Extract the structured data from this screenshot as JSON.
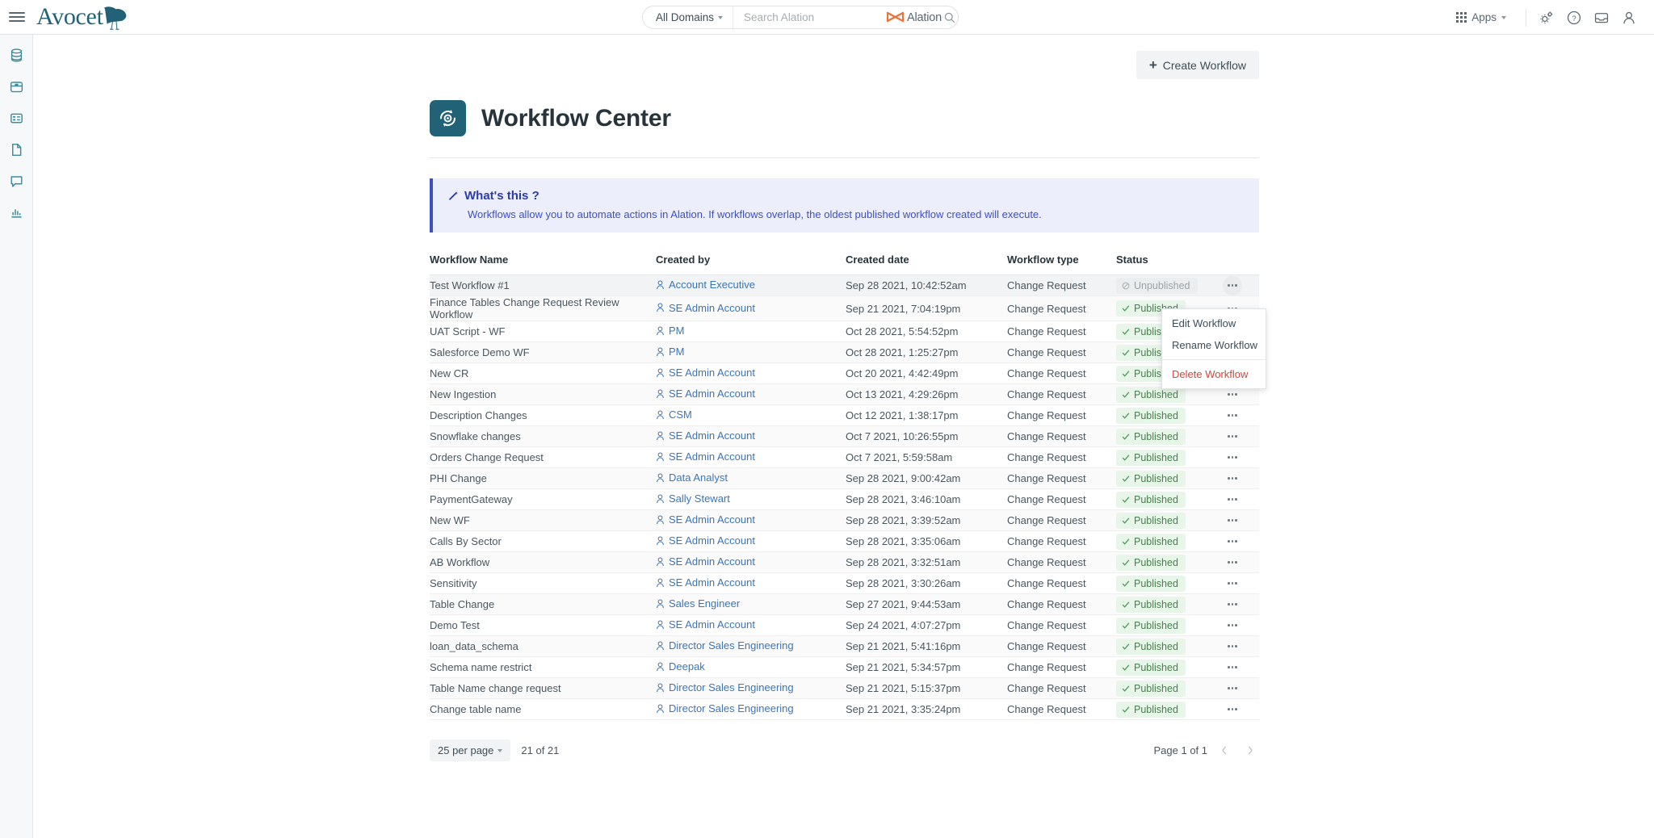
{
  "topbar": {
    "brand": "Avocet",
    "domain_selector": "All Domains",
    "search_placeholder": "Search Alation",
    "alation_label": "Alation",
    "apps_label": "Apps"
  },
  "sidebar": {
    "items": [
      {
        "name": "sidebar-item-sources",
        "icon": "database-icon"
      },
      {
        "name": "sidebar-item-catalog",
        "icon": "archive-box-icon"
      },
      {
        "name": "sidebar-item-tables",
        "icon": "table-icon"
      },
      {
        "name": "sidebar-item-documents",
        "icon": "document-icon"
      },
      {
        "name": "sidebar-item-conversations",
        "icon": "chat-bubble-icon"
      },
      {
        "name": "sidebar-item-analytics",
        "icon": "bar-chart-icon"
      }
    ]
  },
  "header": {
    "create_button": "Create Workflow",
    "title": "Workflow Center"
  },
  "banner": {
    "title": "What's this ?",
    "body": "Workflows allow you to automate actions in Alation. If workflows overlap, the oldest published workflow created will execute."
  },
  "table": {
    "columns": [
      "Workflow Name",
      "Created by",
      "Created date",
      "Workflow type",
      "Status"
    ],
    "rows": [
      {
        "name": "Test Workflow #1",
        "created_by": "Account Executive",
        "created_date": "Sep 28 2021, 10:42:52am",
        "type": "Change Request",
        "status": "Unpublished"
      },
      {
        "name": "Finance Tables Change Request Review Workflow",
        "created_by": "SE Admin Account",
        "created_date": "Sep 21 2021, 7:04:19pm",
        "type": "Change Request",
        "status": "Published"
      },
      {
        "name": "UAT Script - WF",
        "created_by": "PM",
        "created_date": "Oct 28 2021, 5:54:52pm",
        "type": "Change Request",
        "status": "Published"
      },
      {
        "name": "Salesforce Demo WF",
        "created_by": "PM",
        "created_date": "Oct 28 2021, 1:25:27pm",
        "type": "Change Request",
        "status": "Published"
      },
      {
        "name": "New CR",
        "created_by": "SE Admin Account",
        "created_date": "Oct 20 2021, 4:42:49pm",
        "type": "Change Request",
        "status": "Published"
      },
      {
        "name": "New Ingestion",
        "created_by": "SE Admin Account",
        "created_date": "Oct 13 2021, 4:29:26pm",
        "type": "Change Request",
        "status": "Published"
      },
      {
        "name": "Description Changes",
        "created_by": "CSM",
        "created_date": "Oct 12 2021, 1:38:17pm",
        "type": "Change Request",
        "status": "Published"
      },
      {
        "name": "Snowflake changes",
        "created_by": "SE Admin Account",
        "created_date": "Oct 7 2021, 10:26:55pm",
        "type": "Change Request",
        "status": "Published"
      },
      {
        "name": "Orders Change Request",
        "created_by": "SE Admin Account",
        "created_date": "Oct 7 2021, 5:59:58am",
        "type": "Change Request",
        "status": "Published"
      },
      {
        "name": "PHI Change",
        "created_by": "Data Analyst",
        "created_date": "Sep 28 2021, 9:00:42am",
        "type": "Change Request",
        "status": "Published"
      },
      {
        "name": "PaymentGateway",
        "created_by": "Sally Stewart",
        "created_date": "Sep 28 2021, 3:46:10am",
        "type": "Change Request",
        "status": "Published"
      },
      {
        "name": "New WF",
        "created_by": "SE Admin Account",
        "created_date": "Sep 28 2021, 3:39:52am",
        "type": "Change Request",
        "status": "Published"
      },
      {
        "name": "Calls By Sector",
        "created_by": "SE Admin Account",
        "created_date": "Sep 28 2021, 3:35:06am",
        "type": "Change Request",
        "status": "Published"
      },
      {
        "name": "AB Workflow",
        "created_by": "SE Admin Account",
        "created_date": "Sep 28 2021, 3:32:51am",
        "type": "Change Request",
        "status": "Published"
      },
      {
        "name": "Sensitivity",
        "created_by": "SE Admin Account",
        "created_date": "Sep 28 2021, 3:30:26am",
        "type": "Change Request",
        "status": "Published"
      },
      {
        "name": "Table Change",
        "created_by": "Sales Engineer",
        "created_date": "Sep 27 2021, 9:44:53am",
        "type": "Change Request",
        "status": "Published"
      },
      {
        "name": "Demo Test",
        "created_by": "SE Admin Account",
        "created_date": "Sep 24 2021, 4:07:27pm",
        "type": "Change Request",
        "status": "Published"
      },
      {
        "name": "loan_data_schema",
        "created_by": "Director Sales Engineering",
        "created_date": "Sep 21 2021, 5:41:16pm",
        "type": "Change Request",
        "status": "Published"
      },
      {
        "name": "Schema name restrict",
        "created_by": "Deepak",
        "created_date": "Sep 21 2021, 5:34:57pm",
        "type": "Change Request",
        "status": "Published"
      },
      {
        "name": "Table Name change request",
        "created_by": "Director Sales Engineering",
        "created_date": "Sep 21 2021, 5:15:37pm",
        "type": "Change Request",
        "status": "Published"
      },
      {
        "name": "Change table name",
        "created_by": "Director Sales Engineering",
        "created_date": "Sep 21 2021, 3:35:24pm",
        "type": "Change Request",
        "status": "Published"
      }
    ]
  },
  "context_menu": {
    "edit": "Edit Workflow",
    "rename": "Rename Workflow",
    "delete": "Delete Workflow"
  },
  "pagination": {
    "per_page": "25 per page",
    "count": "21 of 21",
    "page_label": "Page 1 of 1"
  },
  "colors": {
    "brand_teal": "#226277",
    "link_blue": "#3a76b8",
    "published_green": "#4a7f50",
    "danger_red": "#d0463a",
    "banner_blue": "#3d50c3",
    "alation_orange": "#e8743b"
  }
}
